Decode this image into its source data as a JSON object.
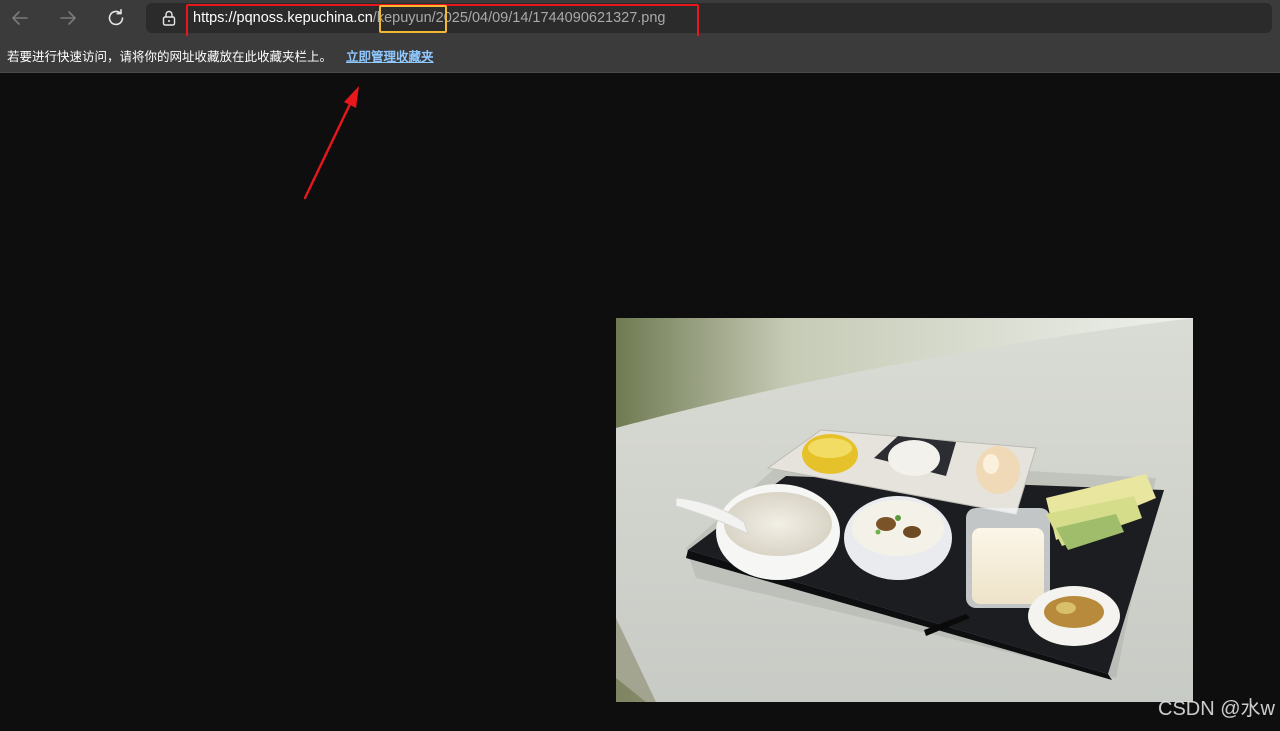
{
  "toolbar": {
    "back_icon": "arrow-left-icon",
    "forward_icon": "arrow-right-icon",
    "refresh_icon": "refresh-icon",
    "lock_icon": "lock-icon",
    "url": {
      "scheme": "https://",
      "domain": "pqnoss.kepuchina.cn",
      "sep1": "/",
      "highlight_segment": "kepuyun",
      "sep2": "/",
      "path": "2025/04/09/14/1744090621327.png"
    }
  },
  "favorites_bar": {
    "message": "若要进行快速访问，请将你的网址收藏放在此收藏夹栏上。",
    "link_label": "立即管理收藏夹"
  },
  "annotation": {
    "red_box_color": "#e8171c",
    "yellow_box_color": "#f3b731",
    "arrow_color": "#e8171c"
  },
  "image": {
    "description_icon": "breakfast-tray-photo"
  },
  "watermark": {
    "text": "CSDN @水w"
  }
}
